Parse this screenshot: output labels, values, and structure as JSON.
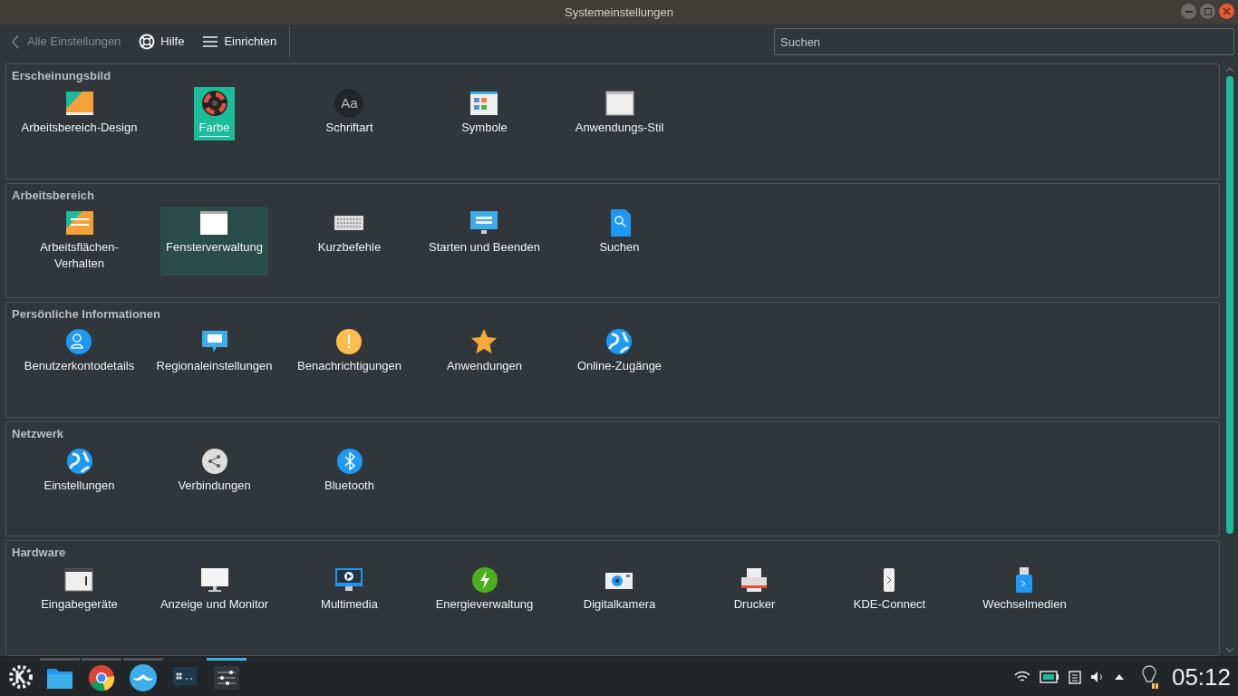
{
  "window": {
    "title": "Systemeinstellungen"
  },
  "toolbar": {
    "back": {
      "label": "Alle Einstellungen",
      "disabled": true
    },
    "buttons": [
      "Hilfe",
      "Einrichten"
    ],
    "search": {
      "placeholder": "Suchen"
    }
  },
  "sections": [
    {
      "title": "Erscheinungsbild",
      "items": [
        {
          "label": "Arbeitsbereich-Design",
          "selected": false,
          "hovered": false
        },
        {
          "label": "Farbe",
          "selected": true,
          "hovered": false
        },
        {
          "label": "Schriftart",
          "selected": false,
          "hovered": false,
          "icon_text": "Aa"
        },
        {
          "label": "Symbole",
          "selected": false,
          "hovered": false
        },
        {
          "label": "Anwendungs-Stil",
          "selected": false,
          "hovered": false
        }
      ]
    },
    {
      "title": "Arbeitsbereich",
      "items": [
        {
          "label": "Arbeitsflächen-Verhalten",
          "selected": false,
          "hovered": false
        },
        {
          "label": "Fensterverwaltung",
          "selected": false,
          "hovered": true
        },
        {
          "label": "Kurzbefehle",
          "selected": false,
          "hovered": false
        },
        {
          "label": "Starten und Beenden",
          "selected": false,
          "hovered": false
        },
        {
          "label": "Suchen",
          "selected": false,
          "hovered": false
        }
      ]
    },
    {
      "title": "Persönliche Informationen",
      "items": [
        {
          "label": "Benutzerkontodetails",
          "selected": false,
          "hovered": false
        },
        {
          "label": "Regionaleinstellungen",
          "selected": false,
          "hovered": false
        },
        {
          "label": "Benachrichtigungen",
          "selected": false,
          "hovered": false
        },
        {
          "label": "Anwendungen",
          "selected": false,
          "hovered": false
        },
        {
          "label": "Online-Zugänge",
          "selected": false,
          "hovered": false
        }
      ]
    },
    {
      "title": "Netzwerk",
      "items": [
        {
          "label": "Einstellungen",
          "selected": false,
          "hovered": false
        },
        {
          "label": "Verbindungen",
          "selected": false,
          "hovered": false
        },
        {
          "label": "Bluetooth",
          "selected": false,
          "hovered": false
        }
      ]
    },
    {
      "title": "Hardware",
      "items": [
        {
          "label": "Eingabegeräte",
          "selected": false,
          "hovered": false
        },
        {
          "label": "Anzeige und Monitor",
          "selected": false,
          "hovered": false
        },
        {
          "label": "Multimedia",
          "selected": false,
          "hovered": false
        },
        {
          "label": "Energieverwaltung",
          "selected": false,
          "hovered": false
        },
        {
          "label": "Digitalkamera",
          "selected": false,
          "hovered": false
        },
        {
          "label": "Drucker",
          "selected": false,
          "hovered": false
        },
        {
          "label": "KDE-Connect",
          "selected": false,
          "hovered": false
        },
        {
          "label": "Wechselmedien",
          "selected": false,
          "hovered": false
        }
      ]
    }
  ],
  "taskbar": {
    "tasks": [
      {
        "running": true,
        "selected": false
      },
      {
        "running": true,
        "selected": false
      },
      {
        "running": true,
        "selected": false
      },
      {
        "running": false,
        "selected": false
      },
      {
        "running": true,
        "selected": true
      }
    ],
    "clock": "05:12"
  }
}
